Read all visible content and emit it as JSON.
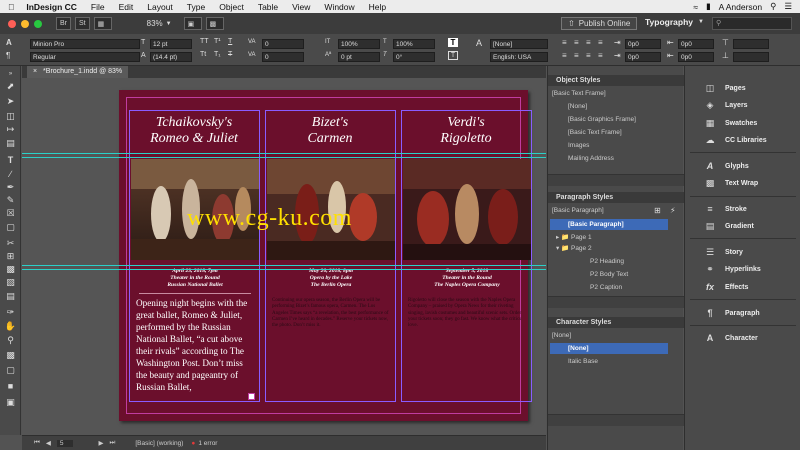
{
  "menubar": {
    "app_name": "InDesign CC",
    "items": [
      "File",
      "Edit",
      "Layout",
      "Type",
      "Object",
      "Table",
      "View",
      "Window",
      "Help"
    ],
    "user": "A Anderson"
  },
  "appbar": {
    "zoom": "83%",
    "publish_label": "Publish Online",
    "workspace": "Typography",
    "btn_br": "Br",
    "btn_st": "St"
  },
  "control": {
    "font_family": "Minion Pro",
    "font_style": "Regular",
    "font_size": "12 pt",
    "leading": "(14.4 pt)",
    "tracking": "0",
    "kerning": "0",
    "scale_v": "100%",
    "scale_h": "100%",
    "baseline": "0 pt",
    "skew": "0°",
    "char_style": "[None]",
    "language": "English: USA",
    "indent_1": "0p0",
    "indent_2": "0p0",
    "indent_3": "0p0",
    "indent_4": "0p0"
  },
  "document": {
    "tab_label": "*Brochure_1.indd @ 83%"
  },
  "page": {
    "columns": [
      {
        "title_line1": "Tchaikovsky's",
        "title_line2": "Romeo & Juliet",
        "date": "April 23, 2018, 7pm",
        "venue": "Theater in the Round",
        "company": "Russian National Ballet",
        "body": "Opening night begins with the great ballet, Romeo & Juliet, performed by the Russian National Ballet, “a cut above their rivals” according to The Washington Post. Don’t miss the beauty and pageantry of Russian Ballet,"
      },
      {
        "title_line1": "Bizet's",
        "title_line2": "Carmen",
        "date": "May 20, 2018, 8pm",
        "venue": "Opera by the Lake",
        "company": "The Berlin Opera",
        "body": "Continuing our opera season, the Berlin Opera will be performing Bizet’s famous opera, Carmen. The Los Angeles Times says “a revelation, the best performance of Carmen I’ve heard in decades.” Reserve your tickets now, the photo. Don’t miss it."
      },
      {
        "title_line1": "Verdi's",
        "title_line2": "Rigoletto",
        "date": "September 5, 2018",
        "venue": "Theater in the Round",
        "company": "The Naples Opera Company",
        "body": "Rigoletto will close the season with the Naples Opera Company – praised by Opera News for their riveting singing, lavish costumes and beautiful scenic sets. Order your tickets soon; they go fast. We know what the critics love."
      }
    ],
    "watermark": "www.cg-ku.com"
  },
  "status": {
    "page_num": "5",
    "preflight_profile": "[Basic] (working)",
    "errors": "1 error"
  },
  "panels": {
    "object_styles": {
      "title": "Object Styles",
      "current": "[Basic Text Frame]",
      "items": [
        "[None]",
        "[Basic Graphics Frame]",
        "[Basic Text Frame]",
        "Images",
        "Mailing Address"
      ]
    },
    "paragraph_styles": {
      "title": "Paragraph Styles",
      "current": "[Basic Paragraph]",
      "items": [
        "[Basic Paragraph]",
        "Page 1",
        "Page 2",
        "P2 Heading",
        "P2 Body Text",
        "P2 Caption"
      ]
    },
    "character_styles": {
      "title": "Character Styles",
      "current": "[None]",
      "items": [
        "[None]",
        "Italic Base"
      ]
    }
  },
  "dock": {
    "items": [
      "Pages",
      "Layers",
      "Swatches",
      "CC Libraries",
      "Glyphs",
      "Text Wrap",
      "Stroke",
      "Gradient",
      "Story",
      "Hyperlinks",
      "Effects",
      "Paragraph",
      "Character"
    ]
  },
  "colors": {
    "page_bg": "#6b0f2c",
    "guide": "#2bd0c8",
    "selection": "#3d6ab7",
    "watermark": "#ffe000"
  }
}
